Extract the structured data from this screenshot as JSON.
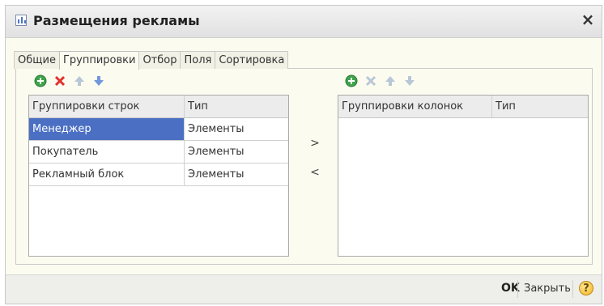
{
  "window": {
    "title": "Размещения рекламы",
    "close_label": "×"
  },
  "tabs": [
    {
      "label": "Общие",
      "active": false
    },
    {
      "label": "Группировки",
      "active": true
    },
    {
      "label": "Отбор",
      "active": false
    },
    {
      "label": "Поля",
      "active": false
    },
    {
      "label": "Сортировка",
      "active": false
    }
  ],
  "row_groupings": {
    "columns": [
      "Группировки строк",
      "Тип"
    ],
    "rows": [
      {
        "name": "Менеджер",
        "type": "Элементы",
        "selected": true
      },
      {
        "name": "Покупатель",
        "type": "Элементы",
        "selected": false
      },
      {
        "name": "Рекламный блок",
        "type": "Элементы",
        "selected": false
      }
    ],
    "toolbar_icons": [
      "add-icon",
      "delete-icon",
      "move-up-icon",
      "move-down-icon"
    ]
  },
  "column_groupings": {
    "columns": [
      "Группировки колонок",
      "Тип"
    ],
    "rows": [],
    "toolbar_icons": [
      "add-icon",
      "delete-icon",
      "move-up-icon",
      "move-down-icon"
    ]
  },
  "transfer": {
    "move_right_label": ">",
    "move_left_label": "<"
  },
  "footer": {
    "ok_label": "OK",
    "close_label": "Закрыть",
    "help_label": "?"
  },
  "colors": {
    "selection": "#4a6fc3",
    "panel_bg": "#fbfbf0",
    "add_green": "#3fa34d",
    "delete_red": "#e0302a",
    "arrow_blue": "#6f97dc",
    "disabled": "#b8c6d6"
  }
}
